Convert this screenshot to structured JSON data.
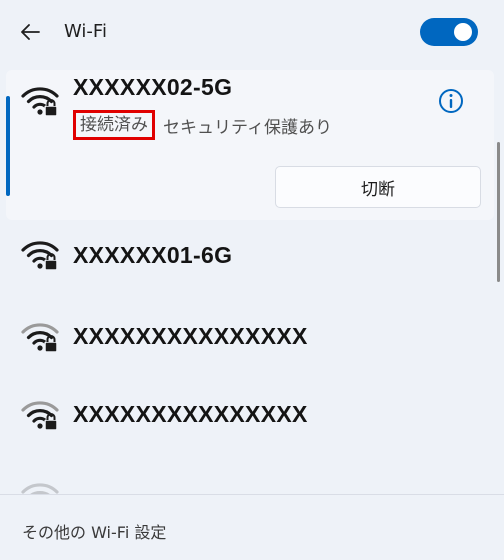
{
  "header": {
    "title": "Wi-Fi",
    "toggle_on": true,
    "accent_color": "#0067c0"
  },
  "networks": [
    {
      "name": "XXXXXX02-5G",
      "status": "接続済み",
      "security": "セキュリティ保護あり",
      "action_label": "切断",
      "connected": true
    },
    {
      "name": "XXXXXX01-6G"
    },
    {
      "name": "XXXXXXXXXXXXXXX"
    },
    {
      "name": "XXXXXXXXXXXXXXX"
    }
  ],
  "footer": {
    "link_label": "その他の Wi-Fi 設定"
  }
}
